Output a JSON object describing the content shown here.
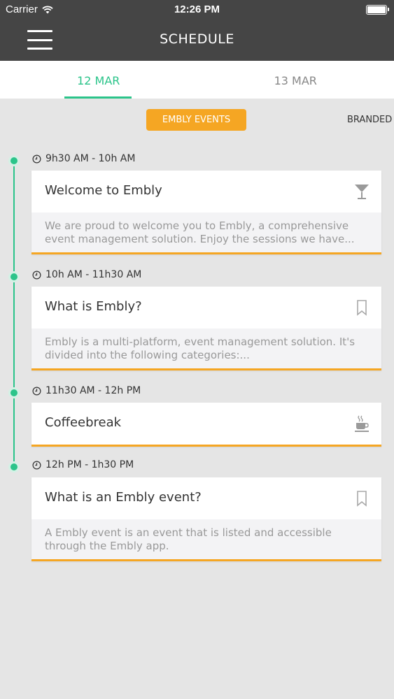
{
  "status_bar": {
    "carrier": "Carrier",
    "time": "12:26 PM"
  },
  "header": {
    "title": "SCHEDULE"
  },
  "date_tabs": [
    {
      "label": "12 MAR",
      "active": true
    },
    {
      "label": "13 MAR",
      "active": false
    }
  ],
  "categories": [
    {
      "label": "EMBLY EVENTS",
      "active": true
    },
    {
      "label": "BRANDED",
      "active": false
    }
  ],
  "colors": {
    "accent_green": "#2bc48a",
    "accent_orange": "#f5a623",
    "header_bg": "#454545"
  },
  "sessions": [
    {
      "time": "9h30 AM - 10h AM",
      "title": "Welcome to Embly",
      "icon": "cocktail-icon",
      "description": "We are proud to welcome you to Embly, a comprehensive event management solution. Enjoy the sessions we have..."
    },
    {
      "time": "10h AM - 11h30 AM",
      "title": "What is Embly?",
      "icon": "bookmark-icon",
      "description": "Embly is a multi-platform, event management solution. It's divided into the following categories:..."
    },
    {
      "time": "11h30 AM - 12h PM",
      "title": "Coffeebreak",
      "icon": "coffee-icon",
      "description": ""
    },
    {
      "time": "12h PM - 1h30 PM",
      "title": "What is an Embly event?",
      "icon": "bookmark-icon",
      "description": "A Embly event is an event that is listed and accessible through the Embly app."
    }
  ]
}
